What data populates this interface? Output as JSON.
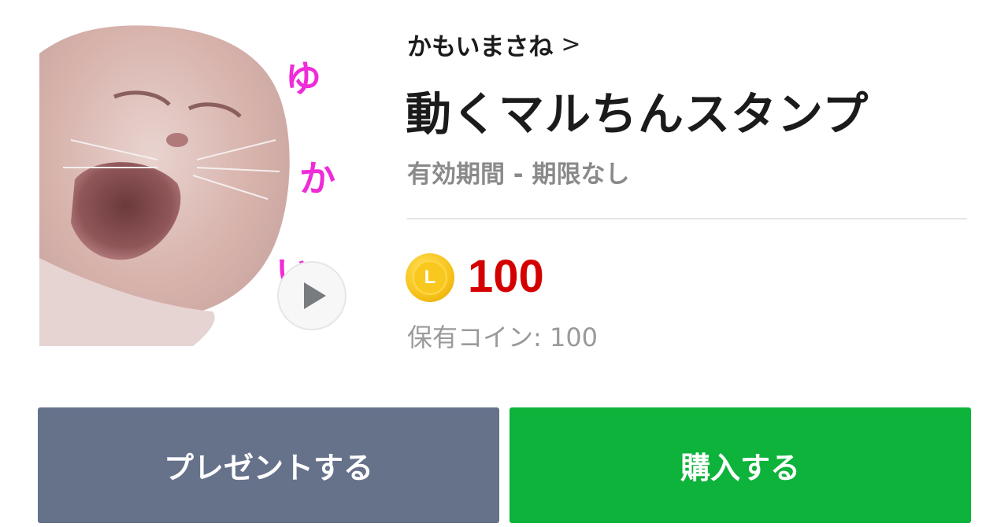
{
  "sticker": {
    "overlay_text": [
      "ゆ",
      "か",
      "い"
    ]
  },
  "author": {
    "name": "かもいまさね",
    "chevron": ">"
  },
  "product": {
    "title": "動くマルちんスタンプ",
    "validity": "有効期間 - 期限なし"
  },
  "price": {
    "coin_letter": "L",
    "amount": "100",
    "owned": "保有コイン: 100"
  },
  "buttons": {
    "gift_label": "プレゼントする",
    "buy_label": "購入する"
  },
  "colors": {
    "price": "#d40000",
    "gift_button": "#66718a",
    "buy_button": "#0db33a",
    "coin": "#f6c21a"
  }
}
